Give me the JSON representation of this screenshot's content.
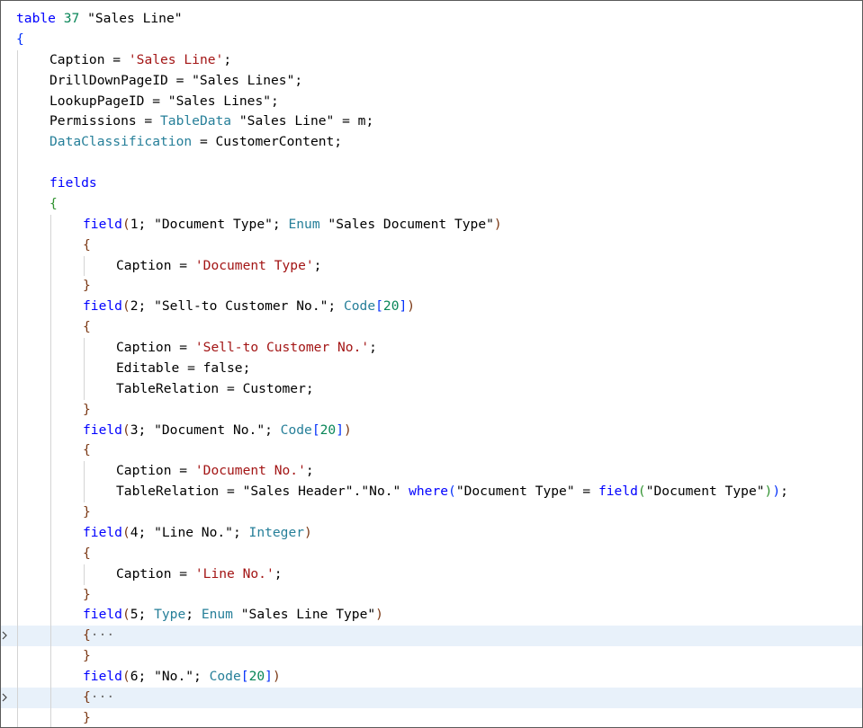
{
  "theme": {
    "keyword": "#0000ff",
    "string": "#a31515",
    "number": "#098658",
    "type": "#267f99",
    "bracket_level1": "#0431fa",
    "bracket_level2": "#319331",
    "bracket_level3": "#7b3814",
    "highlight_line": "#e8f1fa"
  },
  "lines": [
    {
      "indent": 0,
      "guides": 0,
      "highlight": false,
      "fold": false,
      "tokens": [
        [
          "table",
          "kw"
        ],
        [
          " ",
          "plain"
        ],
        [
          "37",
          "num"
        ],
        [
          " \"Sales Line\"",
          "plain"
        ]
      ]
    },
    {
      "indent": 0,
      "guides": 0,
      "highlight": false,
      "fold": false,
      "tokens": [
        [
          "{",
          "br1"
        ]
      ]
    },
    {
      "indent": 1,
      "guides": 1,
      "highlight": false,
      "fold": false,
      "tokens": [
        [
          "Caption = ",
          "plain"
        ],
        [
          "'Sales Line'",
          "str"
        ],
        [
          ";",
          "plain"
        ]
      ]
    },
    {
      "indent": 1,
      "guides": 1,
      "highlight": false,
      "fold": false,
      "tokens": [
        [
          "DrillDownPageID = \"Sales Lines\";",
          "plain"
        ]
      ]
    },
    {
      "indent": 1,
      "guides": 1,
      "highlight": false,
      "fold": false,
      "tokens": [
        [
          "LookupPageID = \"Sales Lines\";",
          "plain"
        ]
      ]
    },
    {
      "indent": 1,
      "guides": 1,
      "highlight": false,
      "fold": false,
      "tokens": [
        [
          "Permissions = ",
          "plain"
        ],
        [
          "TableData",
          "type"
        ],
        [
          " \"Sales Line\" = m;",
          "plain"
        ]
      ]
    },
    {
      "indent": 1,
      "guides": 1,
      "highlight": false,
      "fold": false,
      "tokens": [
        [
          "DataClassification",
          "type"
        ],
        [
          " = CustomerContent;",
          "plain"
        ]
      ]
    },
    {
      "indent": 0,
      "guides": 1,
      "highlight": false,
      "fold": false,
      "tokens": []
    },
    {
      "indent": 1,
      "guides": 1,
      "highlight": false,
      "fold": false,
      "tokens": [
        [
          "fields",
          "kw"
        ]
      ]
    },
    {
      "indent": 1,
      "guides": 1,
      "highlight": false,
      "fold": false,
      "tokens": [
        [
          "{",
          "br2"
        ]
      ]
    },
    {
      "indent": 2,
      "guides": 2,
      "highlight": false,
      "fold": false,
      "tokens": [
        [
          "field",
          "kw"
        ],
        [
          "(",
          "br3"
        ],
        [
          "1; \"Document Type\"; ",
          "plain"
        ],
        [
          "Enum",
          "type"
        ],
        [
          " \"Sales Document Type\"",
          "plain"
        ],
        [
          ")",
          "br3"
        ]
      ]
    },
    {
      "indent": 2,
      "guides": 2,
      "highlight": false,
      "fold": false,
      "tokens": [
        [
          "{",
          "br3"
        ]
      ]
    },
    {
      "indent": 3,
      "guides": 3,
      "highlight": false,
      "fold": false,
      "tokens": [
        [
          "Caption = ",
          "plain"
        ],
        [
          "'Document Type'",
          "str"
        ],
        [
          ";",
          "plain"
        ]
      ]
    },
    {
      "indent": 2,
      "guides": 2,
      "highlight": false,
      "fold": false,
      "tokens": [
        [
          "}",
          "br3"
        ]
      ]
    },
    {
      "indent": 2,
      "guides": 2,
      "highlight": false,
      "fold": false,
      "tokens": [
        [
          "field",
          "kw"
        ],
        [
          "(",
          "br3"
        ],
        [
          "2; \"Sell-to Customer No.\"; ",
          "plain"
        ],
        [
          "Code",
          "type"
        ],
        [
          "[",
          "br1"
        ],
        [
          "20",
          "num"
        ],
        [
          "]",
          "br1"
        ],
        [
          ")",
          "br3"
        ]
      ]
    },
    {
      "indent": 2,
      "guides": 2,
      "highlight": false,
      "fold": false,
      "tokens": [
        [
          "{",
          "br3"
        ]
      ]
    },
    {
      "indent": 3,
      "guides": 3,
      "highlight": false,
      "fold": false,
      "tokens": [
        [
          "Caption = ",
          "plain"
        ],
        [
          "'Sell-to Customer No.'",
          "str"
        ],
        [
          ";",
          "plain"
        ]
      ]
    },
    {
      "indent": 3,
      "guides": 3,
      "highlight": false,
      "fold": false,
      "tokens": [
        [
          "Editable = false;",
          "plain"
        ]
      ]
    },
    {
      "indent": 3,
      "guides": 3,
      "highlight": false,
      "fold": false,
      "tokens": [
        [
          "TableRelation = Customer;",
          "plain"
        ]
      ]
    },
    {
      "indent": 2,
      "guides": 2,
      "highlight": false,
      "fold": false,
      "tokens": [
        [
          "}",
          "br3"
        ]
      ]
    },
    {
      "indent": 2,
      "guides": 2,
      "highlight": false,
      "fold": false,
      "tokens": [
        [
          "field",
          "kw"
        ],
        [
          "(",
          "br3"
        ],
        [
          "3; \"Document No.\"; ",
          "plain"
        ],
        [
          "Code",
          "type"
        ],
        [
          "[",
          "br1"
        ],
        [
          "20",
          "num"
        ],
        [
          "]",
          "br1"
        ],
        [
          ")",
          "br3"
        ]
      ]
    },
    {
      "indent": 2,
      "guides": 2,
      "highlight": false,
      "fold": false,
      "tokens": [
        [
          "{",
          "br3"
        ]
      ]
    },
    {
      "indent": 3,
      "guides": 3,
      "highlight": false,
      "fold": false,
      "tokens": [
        [
          "Caption = ",
          "plain"
        ],
        [
          "'Document No.'",
          "str"
        ],
        [
          ";",
          "plain"
        ]
      ]
    },
    {
      "indent": 3,
      "guides": 3,
      "highlight": false,
      "fold": false,
      "tokens": [
        [
          "TableRelation = \"Sales Header\".\"No.\" ",
          "plain"
        ],
        [
          "where",
          "kw"
        ],
        [
          "(",
          "br1"
        ],
        [
          "\"Document Type\" = ",
          "plain"
        ],
        [
          "field",
          "kw"
        ],
        [
          "(",
          "br2"
        ],
        [
          "\"Document Type\"",
          "plain"
        ],
        [
          ")",
          "br2"
        ],
        [
          ")",
          "br1"
        ],
        [
          ";",
          "plain"
        ]
      ]
    },
    {
      "indent": 2,
      "guides": 2,
      "highlight": false,
      "fold": false,
      "tokens": [
        [
          "}",
          "br3"
        ]
      ]
    },
    {
      "indent": 2,
      "guides": 2,
      "highlight": false,
      "fold": false,
      "tokens": [
        [
          "field",
          "kw"
        ],
        [
          "(",
          "br3"
        ],
        [
          "4; \"Line No.\"; ",
          "plain"
        ],
        [
          "Integer",
          "type"
        ],
        [
          ")",
          "br3"
        ]
      ]
    },
    {
      "indent": 2,
      "guides": 2,
      "highlight": false,
      "fold": false,
      "tokens": [
        [
          "{",
          "br3"
        ]
      ]
    },
    {
      "indent": 3,
      "guides": 3,
      "highlight": false,
      "fold": false,
      "tokens": [
        [
          "Caption = ",
          "plain"
        ],
        [
          "'Line No.'",
          "str"
        ],
        [
          ";",
          "plain"
        ]
      ]
    },
    {
      "indent": 2,
      "guides": 2,
      "highlight": false,
      "fold": false,
      "tokens": [
        [
          "}",
          "br3"
        ]
      ]
    },
    {
      "indent": 2,
      "guides": 2,
      "highlight": false,
      "fold": false,
      "tokens": [
        [
          "field",
          "kw"
        ],
        [
          "(",
          "br3"
        ],
        [
          "5; ",
          "plain"
        ],
        [
          "Type",
          "type"
        ],
        [
          "; ",
          "plain"
        ],
        [
          "Enum",
          "type"
        ],
        [
          " \"Sales Line Type\"",
          "plain"
        ],
        [
          ")",
          "br3"
        ]
      ]
    },
    {
      "indent": 2,
      "guides": 2,
      "highlight": true,
      "fold": true,
      "tokens": [
        [
          "{",
          "br3"
        ],
        [
          "···",
          "ell"
        ]
      ]
    },
    {
      "indent": 2,
      "guides": 2,
      "highlight": false,
      "fold": false,
      "tokens": [
        [
          "}",
          "br3"
        ]
      ]
    },
    {
      "indent": 2,
      "guides": 2,
      "highlight": false,
      "fold": false,
      "tokens": [
        [
          "field",
          "kw"
        ],
        [
          "(",
          "br3"
        ],
        [
          "6; \"No.\"; ",
          "plain"
        ],
        [
          "Code",
          "type"
        ],
        [
          "[",
          "br1"
        ],
        [
          "20",
          "num"
        ],
        [
          "]",
          "br1"
        ],
        [
          ")",
          "br3"
        ]
      ]
    },
    {
      "indent": 2,
      "guides": 2,
      "highlight": true,
      "fold": true,
      "tokens": [
        [
          "{",
          "br3"
        ],
        [
          "···",
          "ell"
        ]
      ]
    },
    {
      "indent": 2,
      "guides": 2,
      "highlight": false,
      "fold": false,
      "tokens": [
        [
          "}",
          "br3"
        ]
      ]
    }
  ]
}
